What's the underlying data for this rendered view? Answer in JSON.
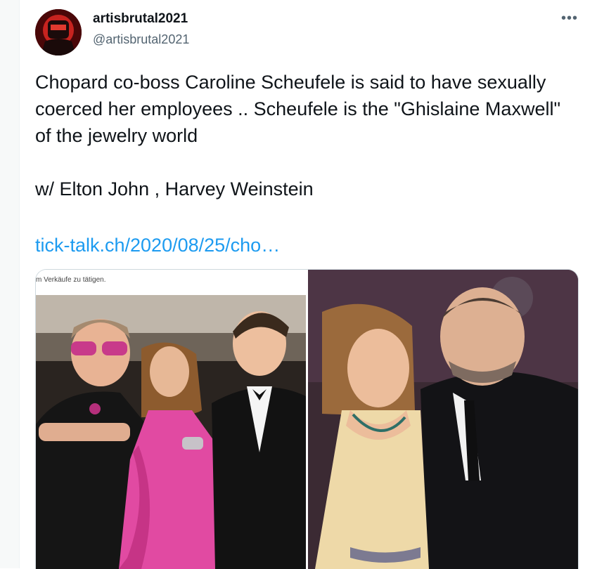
{
  "author": {
    "name": "artisbrutal2021",
    "handle": "@artisbrutal2021",
    "avatar_icon": "masked-figure-avatar"
  },
  "more_icon": "more-horizontal-icon",
  "tweet": {
    "text": "Chopard co-boss Caroline Scheufele is said to have sexually coerced her employees .. Scheufele is the \"Ghislaine Maxwell\" of the jewelry world\n\nw/ Elton John , Harvey Weinstein",
    "link": "tick-talk.ch/2020/08/25/cho…"
  },
  "media": {
    "left_caption": "m Verkäufe zu tätigen."
  },
  "colors": {
    "link": "#1d9bf0",
    "secondary_text": "#536471",
    "border": "#cfd9de"
  }
}
